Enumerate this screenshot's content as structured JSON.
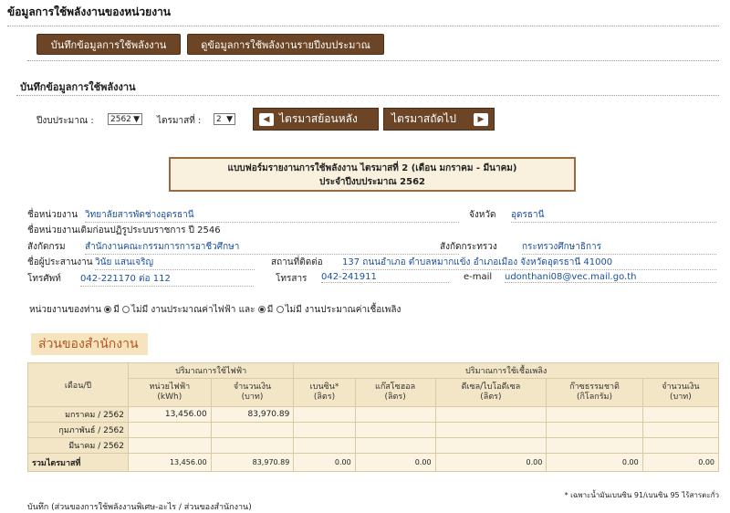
{
  "page_title": "ข้อมูลการใช้พลังงานของหน่วยงาน",
  "top_buttons": {
    "record": "บันทึกข้อมูลการใช้พลังงาน",
    "view": "ดูข้อมูลการใช้พลังงานรายปีงบประมาณ"
  },
  "section_title": "บันทึกข้อมูลการใช้พลังงาน",
  "filters": {
    "year_label": "ปีงบประมาณ :",
    "year_value": "2562",
    "quarter_label": "ไตรมาสที่ :",
    "quarter_value": "2"
  },
  "nav": {
    "prev": "ไตรมาสย้อนหลัง",
    "next": "ไตรมาสถัดไป"
  },
  "form_header": {
    "line1": "แบบฟอร์มรายงานการใช้พลังงาน ไตรมาสที่ 2 (เดือน มกราคม - มีนาคม)",
    "line2": "ประจำปีงบประมาณ 2562"
  },
  "info": {
    "agency_label": "ชื่อหน่วยงาน",
    "agency": "วิทยาลัยสารพัดช่างอุดรธานี",
    "province_label": "จังหวัด",
    "province": "อุดรธานี",
    "old_name": "ชื่อหน่วยงานเดิมก่อนปฏิรูประบบราชการ ปี 2546",
    "dept_label": "สังกัดกรม",
    "dept": "สำนักงานคณะกรรมการการอาชีวศึกษา",
    "ministry_label": "สังกัดกระทรวง",
    "ministry": "กระทรวงศึกษาธิการ",
    "officer_label": "ชื่อผู้ประสานงาน",
    "officer": "วินัย แสนเจริญ",
    "address_label": "สถานที่ติดต่อ",
    "address": "137 ถนนอำเภอ ตำบลหมากแข้ง อำเภอเมือง จังหวัดอุดรธานี 41000",
    "phone_label": "โทรศัพท์",
    "phone": "042-221170 ต่อ 112",
    "fax_label": "โทรสาร",
    "fax": "042-241911",
    "email_label": "e-mail",
    "email": "udonthani08@vec.mail.go.th"
  },
  "radio_row": {
    "prefix": "หน่วยงานของท่าน",
    "yes1": "มี",
    "no1": "ไม่มี งานประมาณค่าไฟฟ้า และ",
    "yes2": "มี",
    "no2": "ไม่มี งานประมาณค่าเชื้อเพลิง"
  },
  "office_section": "ส่วนของสำนักงาน",
  "table": {
    "month_header": "เดือน/ปี",
    "elec_group": "ปริมาณการใช้ไฟฟ้า",
    "fuel_group": "ปริมาณการใช้เชื้อเพลิง",
    "cols": [
      "หน่วยไฟฟ้า\n(kWh)",
      "จำนวนเงิน\n(บาท)",
      "เบนซิน*\n(ลิตร)",
      "แก๊สโซฮอล\n(ลิตร)",
      "ดีเซล/ไบโอดีเซล\n(ลิตร)",
      "ก๊าซธรรมชาติ\n(กิโลกรัม)",
      "จำนวนเงิน\n(บาท)"
    ],
    "rows": [
      {
        "month": "มกราคม / 2562",
        "vals": [
          "13,456.00",
          "83,970.89",
          "",
          "",
          "",
          "",
          ""
        ]
      },
      {
        "month": "กุมภาพันธ์ / 2562",
        "vals": [
          "",
          "",
          "",
          "",
          "",
          "",
          ""
        ]
      },
      {
        "month": "มีนาคม / 2562",
        "vals": [
          "",
          "",
          "",
          "",
          "",
          "",
          ""
        ]
      }
    ],
    "total": {
      "label": "รวมไตรมาสที่",
      "vals": [
        "13,456.00",
        "83,970.89",
        "0.00",
        "0.00",
        "0.00",
        "0.00",
        "0.00"
      ]
    }
  },
  "footnote": "* เฉพาะน้ำมันเบนซิน 91/เบนซิน 95 ไร้สารตะกั่ว",
  "bottom_text": "บันทึก (ส่วนของการใช้พลังงานพิเศษ-อะไร / ส่วนของสำนักงาน)",
  "colors": {
    "button": "#6b4526",
    "accent": "#1a4f9c",
    "table_header": "#f3e6c6"
  }
}
